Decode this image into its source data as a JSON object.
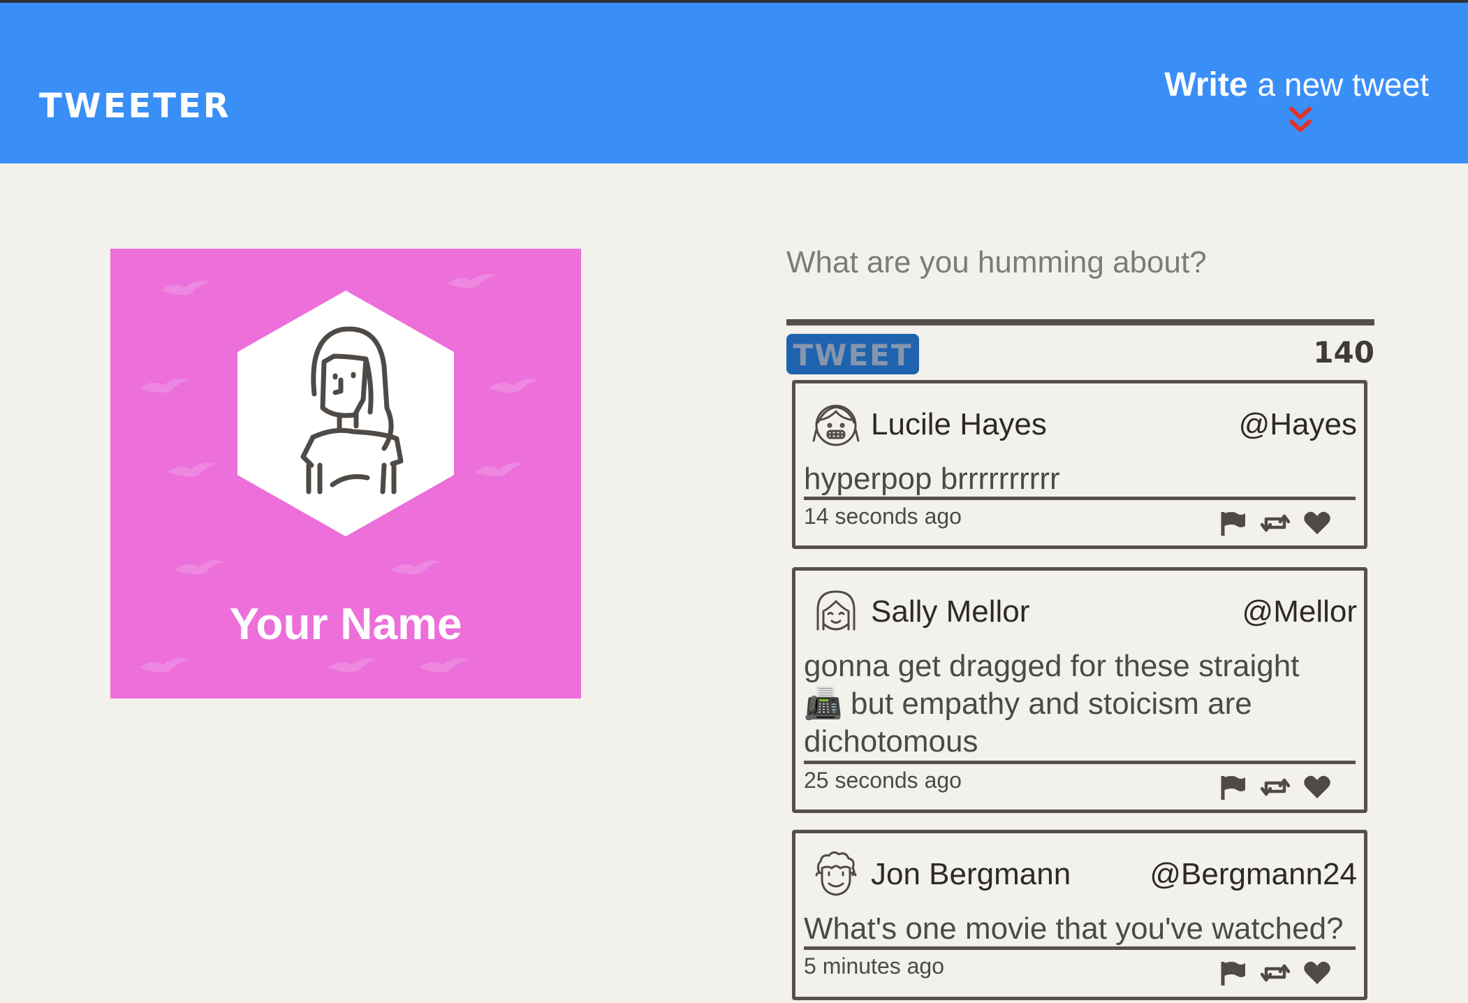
{
  "nav": {
    "brand": "TWEETER",
    "write_bold": "Write",
    "write_rest": "a new tweet"
  },
  "profile": {
    "name": "Your Name",
    "background_color": "#ec6fda"
  },
  "compose": {
    "placeholder": "What are you humming about?",
    "button_label": "TWEET",
    "counter": "140"
  },
  "tweets": [
    {
      "name": "Lucile Hayes",
      "handle": "@Hayes",
      "text": "hyperpop brrrrrrrrrr",
      "time": "14 seconds ago",
      "avatar_icon": "grinning-girl-avatar-icon"
    },
    {
      "name": "Sally Mellor",
      "handle": "@Mellor",
      "text": "gonna get dragged for these straight 📠 but empathy and stoicism are dichotomous",
      "time": "25 seconds ago",
      "avatar_icon": "smiling-girl-avatar-icon"
    },
    {
      "name": "Jon Bergmann",
      "handle": "@Bergmann24",
      "text": "What's one movie that you've watched?",
      "time": "5 minutes ago",
      "avatar_icon": "curly-hair-avatar-icon"
    }
  ],
  "colors": {
    "nav": "#3a8ff6",
    "page": "#f3f1ec",
    "accent_red": "#e2312c",
    "tweet_button": "#1f63ae"
  }
}
